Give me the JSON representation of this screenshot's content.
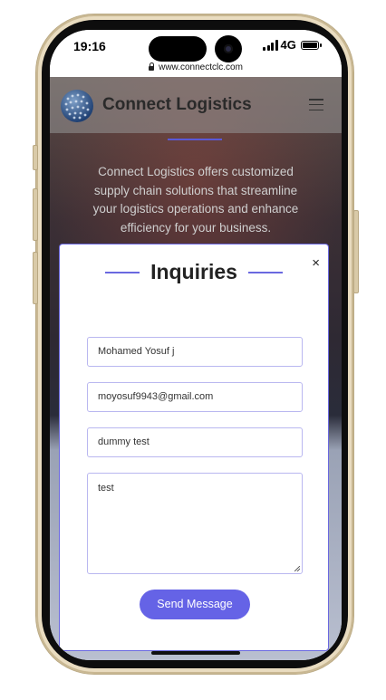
{
  "status_bar": {
    "time": "19:16",
    "network": "4G"
  },
  "browser": {
    "url": "www.connectclc.com"
  },
  "site": {
    "title": "Connect Logistics",
    "hero_text": "Connect Logistics offers customized supply chain solutions that streamline your logistics operations and enhance efficiency for your business."
  },
  "modal": {
    "title": "Inquiries",
    "close_label": "×",
    "fields": {
      "name": "Mohamed Yosuf j",
      "email": "moyosuf9943@gmail.com",
      "subject": "dummy test",
      "message": "test"
    },
    "submit_label": "Send Message"
  },
  "colors": {
    "accent": "#6563e6",
    "phone_frame": "#e9dcc0"
  }
}
